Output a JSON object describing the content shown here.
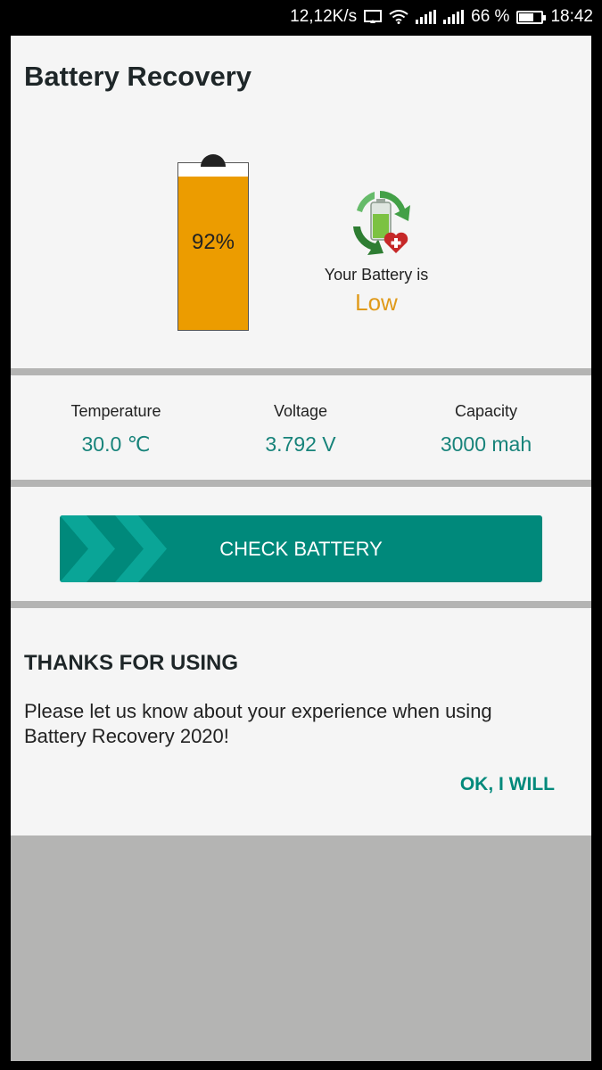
{
  "status_bar": {
    "net_speed": "12,12K/s",
    "battery_percent": "66 %",
    "time": "18:42",
    "icons": [
      "cast-icon",
      "wifi-icon",
      "signal-icon",
      "signal-icon",
      "battery-icon"
    ]
  },
  "header": {
    "title": "Battery Recovery"
  },
  "battery": {
    "percent_label": "92%",
    "level_fraction": 0.92,
    "status_label": "Your Battery is",
    "status_value": "Low",
    "status_icon": "battery-recycle-heart-icon",
    "level_color": "#ec9c00"
  },
  "stats": {
    "temperature": {
      "label": "Temperature",
      "value": "30.0 ℃"
    },
    "voltage": {
      "label": "Voltage",
      "value": "3.792 V"
    },
    "capacity": {
      "label": "Capacity",
      "value": "3000 mah"
    }
  },
  "actions": {
    "check_label": "CHECK BATTERY"
  },
  "thanks": {
    "title": "THANKS FOR USING",
    "body": "Please let us know about your experience when using Battery Recovery 2020!",
    "ok_label": "OK, I WILL"
  },
  "colors": {
    "accent": "#00897b",
    "warning": "#e09a1a",
    "card": "#f5f5f5",
    "divider": "#b4b4b3"
  }
}
